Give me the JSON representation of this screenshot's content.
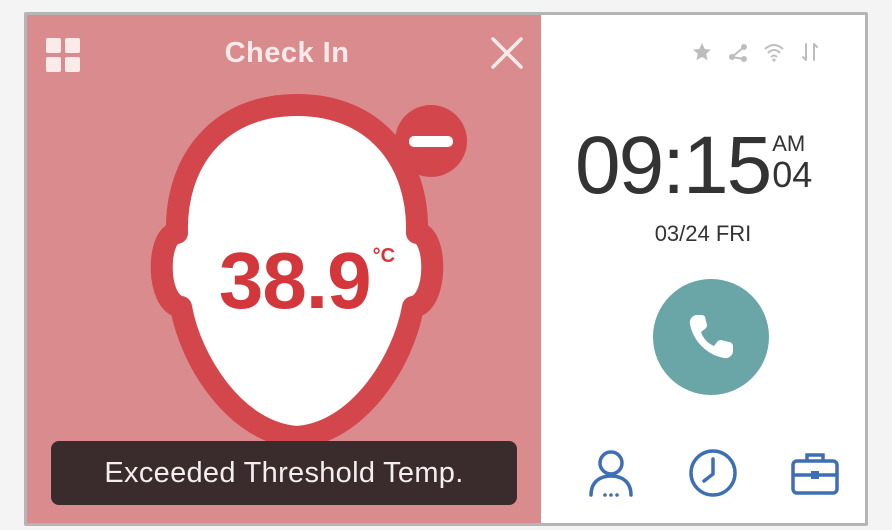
{
  "header": {
    "title": "Check In",
    "menu_icon": "grid-icon",
    "close_icon": "close-icon"
  },
  "temperature": {
    "value": "38.9",
    "unit": "°C",
    "status_icon": "minus-icon"
  },
  "alert": {
    "message": "Exceeded Threshold Temp."
  },
  "status_bar": {
    "icons": [
      "star-icon",
      "share-icon",
      "wifi-icon",
      "sync-icon"
    ]
  },
  "clock": {
    "time": "09:15",
    "ampm": "AM",
    "seconds": "04",
    "date": "03/24 FRI"
  },
  "actions": {
    "call_icon": "phone-icon",
    "bottom_icons": [
      "user-icon",
      "clock-icon",
      "briefcase-icon"
    ]
  },
  "colors": {
    "alert_panel": "#d98b8d",
    "temp_red": "#d3363b",
    "call_teal": "#6aa5a8",
    "icon_blue": "#3e6fb5"
  }
}
